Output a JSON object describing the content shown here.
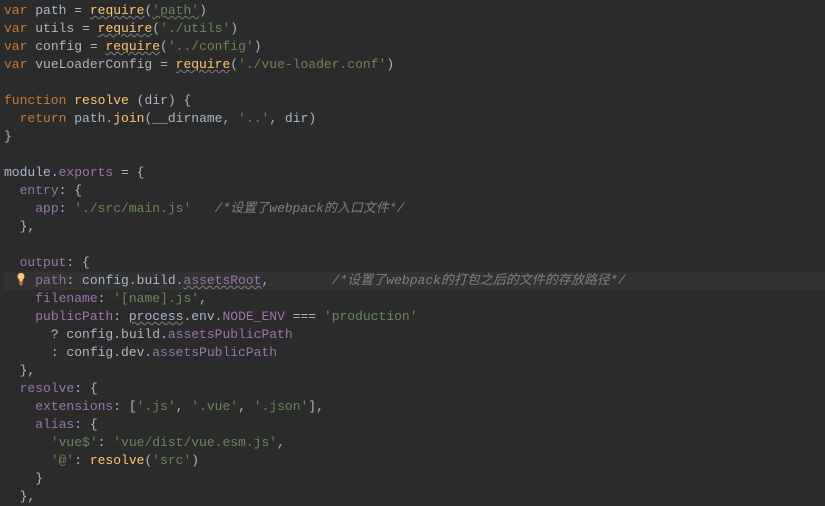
{
  "code": {
    "l1": {
      "var": "var",
      "id": "path",
      "eq": " = ",
      "req": "require",
      "lp": "(",
      "str": "'path'",
      "rp": ")"
    },
    "l2": {
      "var": "var",
      "id": "utils",
      "eq": " = ",
      "req": "require",
      "lp": "(",
      "str": "'./utils'",
      "rp": ")"
    },
    "l3": {
      "var": "var",
      "id": "config",
      "eq": " = ",
      "req": "require",
      "lp": "(",
      "str": "'../config'",
      "rp": ")"
    },
    "l4": {
      "var": "var",
      "id": "vueLoaderConfig",
      "eq": " = ",
      "req": "require",
      "lp": "(",
      "str": "'./vue-loader.conf'",
      "rp": ")"
    },
    "l6": {
      "fn": "function",
      "name": "resolve",
      "sp": " ",
      "lp": "(",
      "param": "dir",
      "rp": ") {"
    },
    "l7": {
      "ret": "return",
      "obj": " path.",
      "method": "join",
      "lp": "(",
      "dirname": "__dirname",
      "c1": ", ",
      "str": "'..'",
      "c2": ", ",
      "param": "dir",
      "rp": ")"
    },
    "l8": {
      "rb": "}"
    },
    "l10": {
      "mod": "module",
      "dot": ".",
      "exp": "exports",
      "eq": " = {"
    },
    "l11": {
      "key": "entry",
      "colon": ": {"
    },
    "l12": {
      "key": "app",
      "colon": ": ",
      "str": "'./src/main.js'",
      "cmt": "   /*设置了webpack的入口文件*/"
    },
    "l13": {
      "rb": "},"
    },
    "l15": {
      "key": "output",
      "colon": ": {"
    },
    "l16": {
      "key": "path",
      "colon": ": config.build.",
      "prop": "assetsRoot",
      "comma": ",",
      "cmt": "        /*设置了webpack的打包之后的文件的存放路径*/"
    },
    "l17": {
      "key": "filename",
      "colon": ": ",
      "str": "'[name].js'",
      "comma": ","
    },
    "l18": {
      "key": "publicPath",
      "colon": ": ",
      "proc": "process",
      "env": ".env.",
      "node": "NODE_ENV",
      "op": " === ",
      "str": "'production'"
    },
    "l19": {
      "q": "? config.build.",
      "prop": "assetsPublicPath"
    },
    "l20": {
      "q": ": config.dev.",
      "prop": "assetsPublicPath"
    },
    "l21": {
      "rb": "},"
    },
    "l22": {
      "key": "resolve",
      "colon": ": {"
    },
    "l23": {
      "key": "extensions",
      "colon": ": [",
      "s1": "'.js'",
      "c1": ", ",
      "s2": "'.vue'",
      "c2": ", ",
      "s3": "'.json'",
      "rb": "],"
    },
    "l24": {
      "key": "alias",
      "colon": ": {"
    },
    "l25": {
      "str1": "'vue$'",
      "colon": ": ",
      "str2": "'vue/dist/vue.esm.js'",
      "comma": ","
    },
    "l26": {
      "str1": "'@'",
      "colon": ": ",
      "fn": "resolve",
      "lp": "(",
      "str2": "'src'",
      "rp": ")"
    },
    "l27": {
      "rb": "}"
    },
    "l28": {
      "rb": "},"
    }
  }
}
